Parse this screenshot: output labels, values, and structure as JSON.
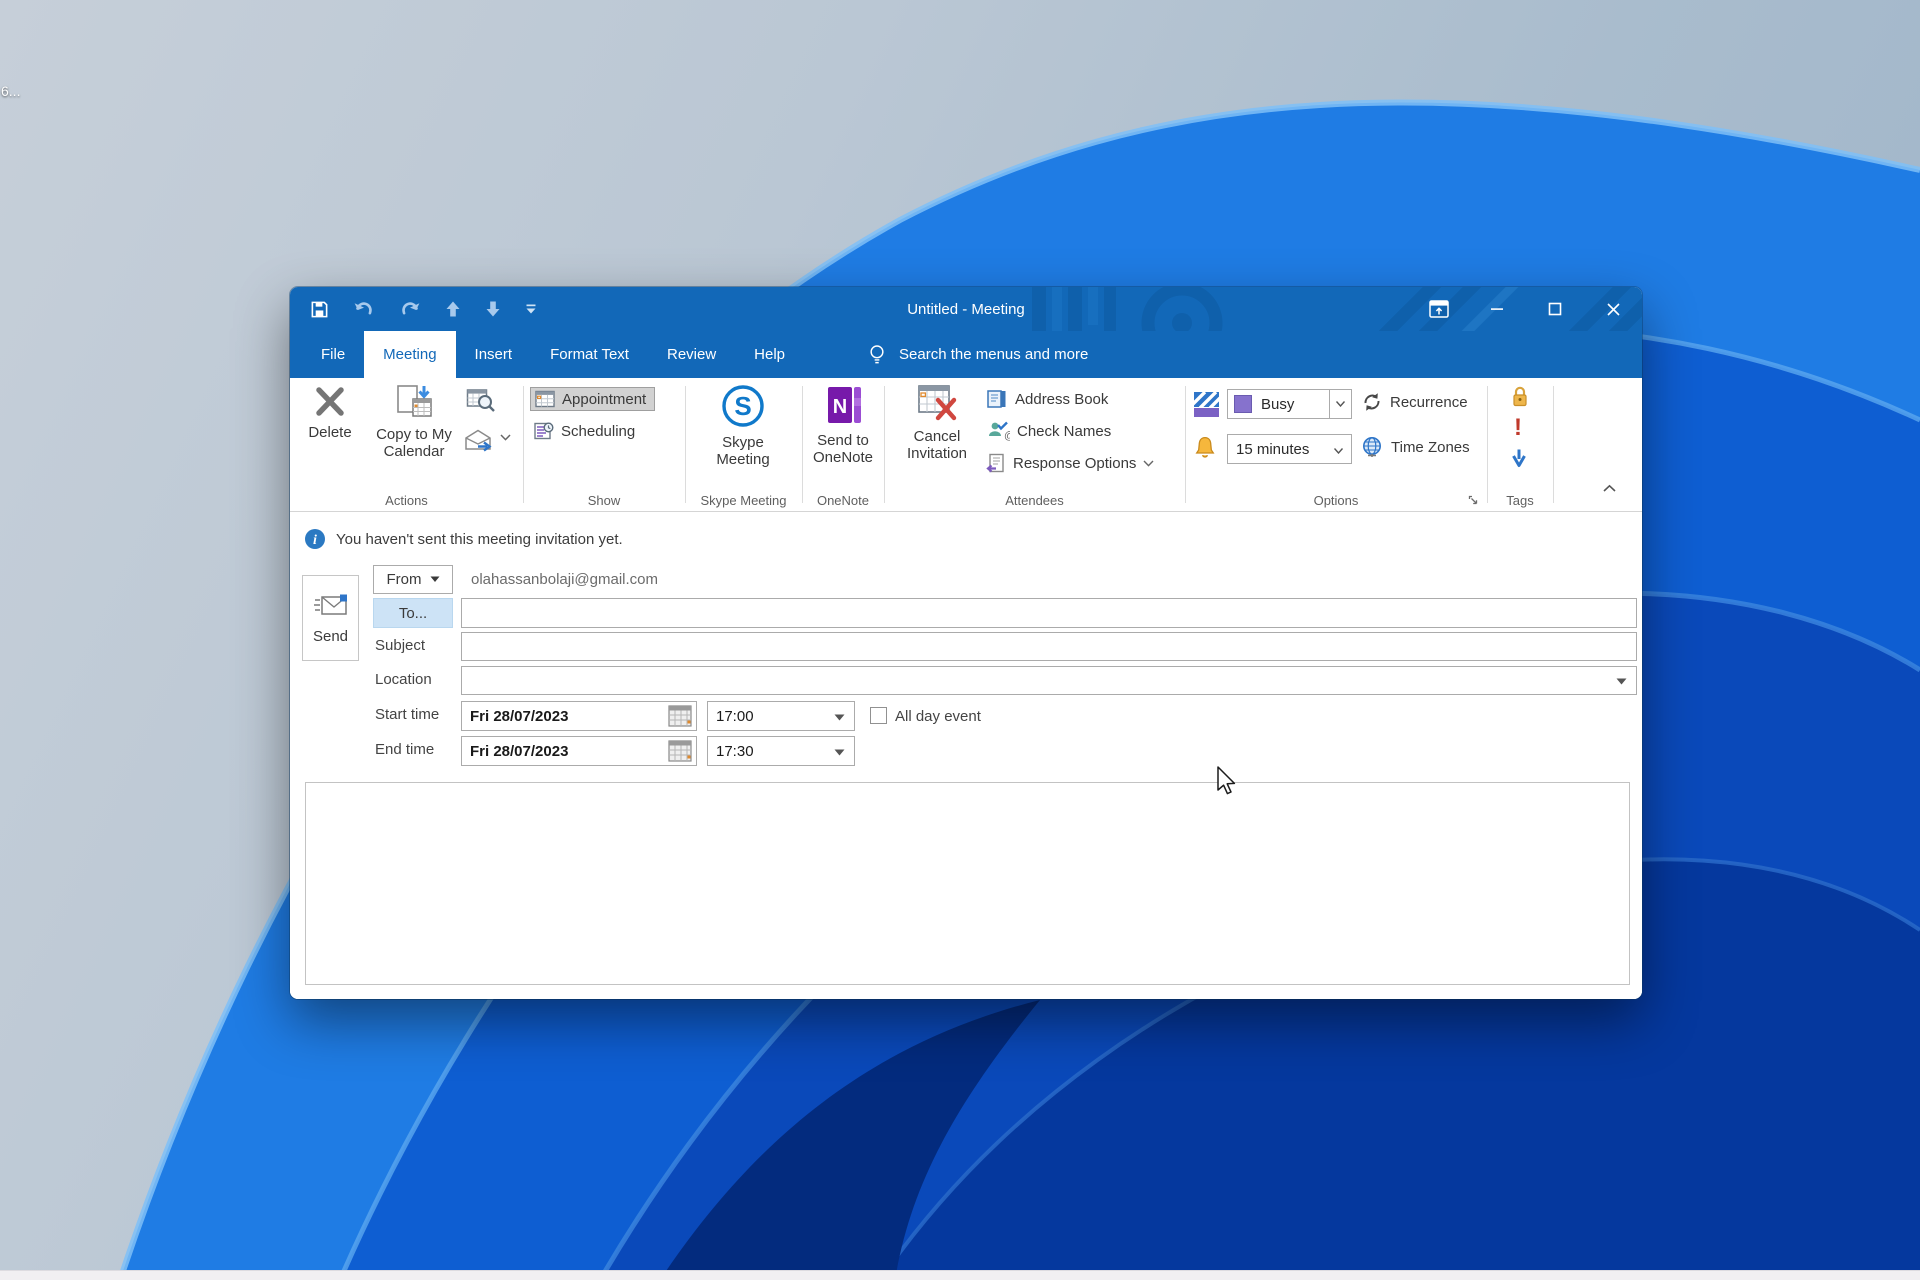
{
  "desktop": {
    "icon_label_fragment": "6...",
    "wallpaper_colors": {
      "sky": "#b7c5d4",
      "bloom_light": "#2f86e8",
      "bloom_mid": "#0e5ed2",
      "bloom_deep": "#0a49ba",
      "bloom_dark": "#05389e"
    }
  },
  "titlebar": {
    "title": "Untitled - Meeting"
  },
  "tabs": {
    "items": [
      "File",
      "Meeting",
      "Insert",
      "Format Text",
      "Review",
      "Help"
    ],
    "active": "Meeting",
    "search_label": "Search the menus and more"
  },
  "ribbon": {
    "actions": {
      "label": "Actions",
      "delete": "Delete",
      "copy_to_my_calendar": "Copy to My Calendar"
    },
    "show": {
      "label": "Show",
      "appointment": "Appointment",
      "scheduling": "Scheduling"
    },
    "skype": {
      "label": "Skype Meeting",
      "skype_meeting": "Skype Meeting"
    },
    "onenote": {
      "label": "OneNote",
      "send_to_onenote": "Send to OneNote"
    },
    "attendees": {
      "label": "Attendees",
      "cancel_invitation": "Cancel Invitation",
      "address_book": "Address Book",
      "check_names": "Check Names",
      "response_options": "Response Options"
    },
    "options": {
      "label": "Options",
      "show_as_value": "Busy",
      "recurrence": "Recurrence",
      "reminder_value": "15 minutes",
      "time_zones": "Time Zones"
    },
    "tags": {
      "label": "Tags"
    }
  },
  "message_bar": {
    "text": "You haven't sent this meeting invitation yet."
  },
  "form": {
    "send": "Send",
    "from_button": "From",
    "from_value": "olahassanbolaji@gmail.com",
    "to_button": "To...",
    "to_value": "",
    "subject_label": "Subject",
    "subject_value": "",
    "location_label": "Location",
    "location_value": "",
    "start_label": "Start time",
    "start_date": "Fri 28/07/2023",
    "start_time": "17:00",
    "all_day_label": "All day event",
    "all_day_checked": false,
    "end_label": "End time",
    "end_date": "Fri 28/07/2023",
    "end_time": "17:30",
    "body_value": ""
  },
  "glyphs": {
    "skype": "S",
    "onenote": "N",
    "info": "i",
    "high_importance": "!"
  },
  "colors": {
    "accent_blue": "#1268b8",
    "tab_active_text": "#1268b8",
    "busy_purple": "#8672cd",
    "reminder_bell": "#f2a93b",
    "high_importance_red": "#c0392b",
    "low_importance_blue": "#2e75c8",
    "selected_button_bg": "#d2d2d2",
    "to_button_bg": "#cde3f6"
  }
}
